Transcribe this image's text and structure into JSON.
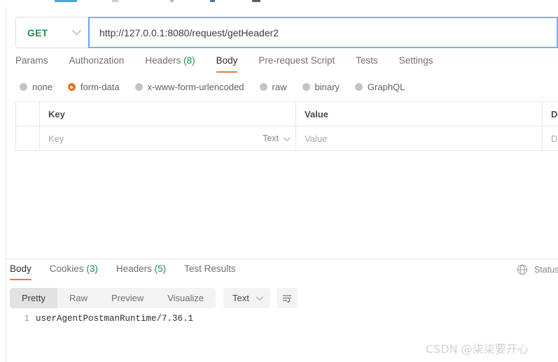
{
  "request": {
    "method": "GET",
    "method_color": "#1d8f4e",
    "url": "http://127.0.0.1:8080/request/getHeader2",
    "url_focus_color": "#7aaef5",
    "tabs": [
      {
        "label": "Params",
        "active": false
      },
      {
        "label": "Authorization",
        "active": false
      },
      {
        "label": "Headers",
        "count": "(8)",
        "active": false
      },
      {
        "label": "Body",
        "active": true
      },
      {
        "label": "Pre-request Script",
        "active": false
      },
      {
        "label": "Tests",
        "active": false
      },
      {
        "label": "Settings",
        "active": false
      }
    ],
    "body_types": [
      {
        "label": "none",
        "selected": false
      },
      {
        "label": "form-data",
        "selected": true
      },
      {
        "label": "x-www-form-urlencoded",
        "selected": false
      },
      {
        "label": "raw",
        "selected": false
      },
      {
        "label": "binary",
        "selected": false
      },
      {
        "label": "GraphQL",
        "selected": false
      }
    ],
    "table": {
      "headers": {
        "key": "Key",
        "value": "Value",
        "description": "D"
      },
      "row": {
        "key_placeholder": "Key",
        "type_value": "Text",
        "value_placeholder": "Value",
        "description_placeholder": "D"
      }
    }
  },
  "response": {
    "tabs": [
      {
        "label": "Body",
        "active": true
      },
      {
        "label": "Cookies",
        "count": "(3)",
        "active": false
      },
      {
        "label": "Headers",
        "count": "(5)",
        "active": false
      },
      {
        "label": "Test Results",
        "active": false
      }
    ],
    "status_label": "Status",
    "view_modes": [
      {
        "label": "Pretty",
        "active": true
      },
      {
        "label": "Raw",
        "active": false
      },
      {
        "label": "Preview",
        "active": false
      },
      {
        "label": "Visualize",
        "active": false
      }
    ],
    "format": "Text",
    "code": {
      "line_number": "1",
      "content": "userAgentPostmanRuntime/7.36.1"
    }
  },
  "watermark": "CSDN @柒柒要开心",
  "theme": {
    "accent_orange": "#ef7a2e",
    "accent_green": "#1d8f4e",
    "radio_selected": "#ef6c23",
    "border": "#e8e8e8"
  }
}
